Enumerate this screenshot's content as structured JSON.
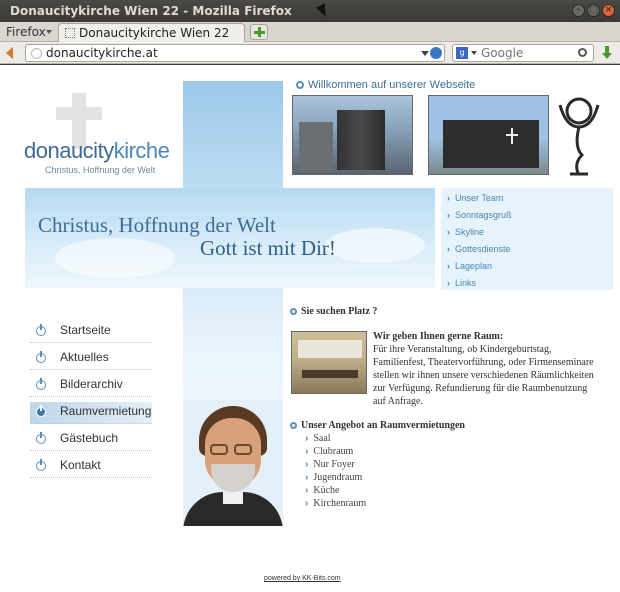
{
  "window": {
    "title": "Donaucitykirche Wien 22 - Mozilla Firefox",
    "menu_label": "Firefox",
    "tab_label": "Donaucitykirche Wien 22",
    "url": "donaucitykirche.at",
    "search_placeholder": "Google"
  },
  "header": {
    "logo_part1": "donaucity",
    "logo_part2": "kirche",
    "logo_subtitle": "Christus, Hoffnung der Welt",
    "slogan_line1": "Christus, Hoffnung der Welt",
    "slogan_line2": "Gott ist mit Dir!",
    "welcome": "Willkommen auf unserer Webseite"
  },
  "subnav": {
    "items": [
      "Unser Team",
      "Sonntagsgruß",
      "Skyline",
      "Gottesdienste",
      "Lageplan",
      "Links"
    ]
  },
  "mainnav": {
    "items": [
      "Startseite",
      "Aktuelles",
      "Bilderarchiv",
      "Raumvermietung",
      "Gästebuch",
      "Kontakt"
    ],
    "active": "Raumvermietung"
  },
  "content": {
    "heading": "Sie suchen Platz ?",
    "lead": "Wir geben Ihnen gerne Raum:",
    "body": "Für ihre Veranstaltung, ob Kindergeburtstag, Familienfest, Theatervorführung, oder Firmenseminare stellen wir ihnen unsere verschiedenen Räumlichkeiten zur Verfügung. Refundierung für die Raumbenutzung auf Anfrage.",
    "offer_heading": "Unser Angebot an Raumvermietungen",
    "offers": [
      "Saal",
      "Clubraum",
      "Nur Foyer",
      "Jugendraum",
      "Küche",
      "Kirchenraum"
    ]
  },
  "footer": {
    "text": "powered by KK-Bits.com"
  }
}
